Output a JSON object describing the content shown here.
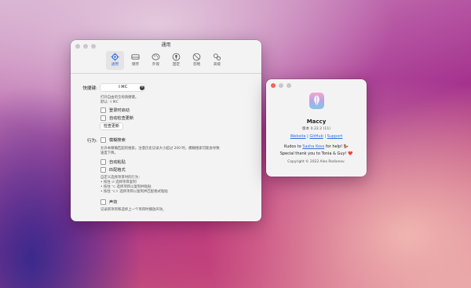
{
  "settings": {
    "title": "通用",
    "tabs": [
      {
        "label": "通用",
        "icon": "gear-icon"
      },
      {
        "label": "储存",
        "icon": "storage-icon"
      },
      {
        "label": "外观",
        "icon": "palette-icon"
      },
      {
        "label": "固定",
        "icon": "pin-icon"
      },
      {
        "label": "忽略",
        "icon": "block-icon"
      },
      {
        "label": "高级",
        "icon": "gears-icon"
      }
    ],
    "hotkey": {
      "label": "快捷键:",
      "value": "⇧⌘C",
      "hint1": "打开自由的全局快捷键。",
      "hint2": "默认: ⇧⌘C"
    },
    "launch_at_login": "登录时启动",
    "auto_check_updates": "自动检查更新",
    "check_updates_button": "检查更新",
    "behavior": {
      "label": "行为:",
      "fuzzy_search": "模糊搜索",
      "fuzzy_hint1": "允许本精确匹配的搜索。注意历史记录大小超过 200 时，模糊搜索可能会导致",
      "fuzzy_hint2": "速度下降。",
      "auto_paste": "自动粘贴",
      "match_format": "匹配格式",
      "notes": [
        "自定义选择项目时的行为：",
        "• 按住 ⏎ 选择项目复制",
        "• 按住 ⌥ 选择项目以复制并粘贴",
        "• 按住 ⌥⇧ 选择项目以复制并匹配格式粘贴"
      ],
      "sound": "声效",
      "sound_hint": "记录新项目和选择上一个项目时播放声效。"
    }
  },
  "about": {
    "app_name": "Maccy",
    "version": "版本 0.22.2 (11)",
    "links": [
      "Website",
      "GitHub",
      "Support"
    ],
    "separator": "|",
    "kudos_prefix": "Kudos to ",
    "kudos_name": "Sasha Koss",
    "kudos_suffix": " for help! 🦫",
    "thanks": "Special thank you to Tonia & Guy! ❤️",
    "copyright": "Copyright © 2022 Alex Rodionov."
  },
  "colors": {
    "accent": "#2e6fdc",
    "close": "#ff5f57",
    "window_bg": "#f4f3f4"
  }
}
